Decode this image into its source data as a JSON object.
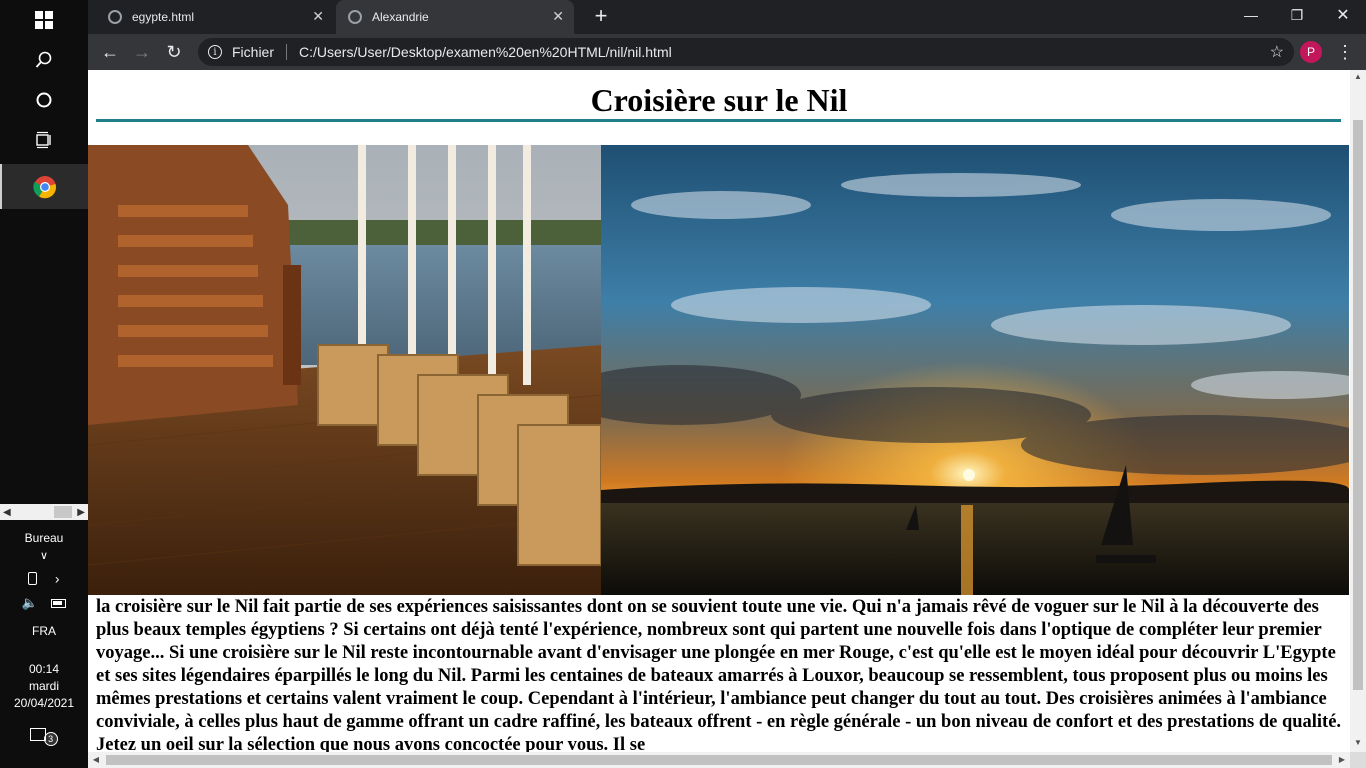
{
  "taskbar": {
    "bureau_label": "Bureau",
    "language": "FRA",
    "time": "00:14",
    "day": "mardi",
    "date": "20/04/2021",
    "notification_count": "3"
  },
  "browser": {
    "tabs": [
      {
        "label": "egypte.html",
        "active": false
      },
      {
        "label": "Alexandrie",
        "active": true
      }
    ],
    "address_scheme_label": "Fichier",
    "address_url": "C:/Users/User/Desktop/examen%20en%20HTML/nil/nil.html",
    "profile_initial": "P"
  },
  "page": {
    "title": "Croisière sur le Nil",
    "paragraph": "la croisière sur le Nil fait partie de ses expériences saisissantes dont on se souvient toute une vie. Qui n'a jamais rêvé de voguer sur le Nil à la découverte des plus beaux temples égyptiens ? Si certains ont déjà tenté l'expérience, nombreux sont qui partent une nouvelle fois dans l'optique de compléter leur premier voyage... Si une croisière sur le Nil reste incontournable avant d'envisager une plongée en mer Rouge, c'est qu'elle est le moyen idéal pour découvrir L'Egypte et ses sites légendaires éparpillés le long du Nil. Parmi les centaines de bateaux amarrés à Louxor, beaucoup se ressemblent, tous proposent plus ou moins les mêmes prestations et certains valent vraiment le coup. Cependant à l'intérieur, l'ambiance peut changer du tout au tout. Des croisières animées à l'ambiance conviviale, à celles plus haut de gamme offrant un cadre raffiné, les bateaux offrent - en règle générale - un bon niveau de confort et des prestations de qualité. Jetez un oeil sur la sélection que nous avons concoctée pour vous. Il se"
  }
}
